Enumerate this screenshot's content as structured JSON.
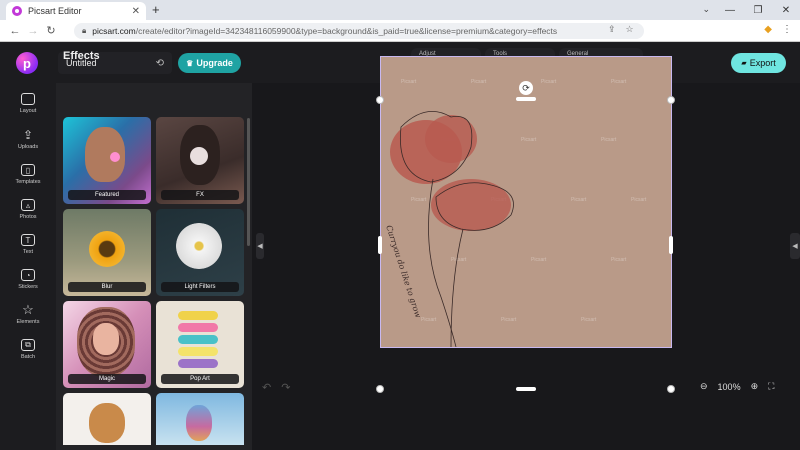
{
  "browser": {
    "tab_title": "Picsart Editor",
    "url_host": "picsart.com",
    "url_rest": "/create/editor?imageId=342348116059900&type=background&is_paid=true&license=premium&category=effects"
  },
  "app": {
    "document_title": "Untitled",
    "upgrade_label": "Upgrade",
    "export_label": "Export",
    "tool_groups": [
      {
        "label": "Adjust"
      },
      {
        "label": "Tools"
      },
      {
        "label": "General"
      }
    ],
    "zoom_level": "100%"
  },
  "sidebar": {
    "items": [
      {
        "label": "Layout",
        "icon": "layout-icon"
      },
      {
        "label": "Uploads",
        "icon": "upload-icon"
      },
      {
        "label": "Templates",
        "icon": "templates-icon"
      },
      {
        "label": "Photos",
        "icon": "photos-icon"
      },
      {
        "label": "Text",
        "icon": "text-icon"
      },
      {
        "label": "Stickers",
        "icon": "stickers-icon"
      },
      {
        "label": "Elements",
        "icon": "elements-icon"
      },
      {
        "label": "Batch",
        "icon": "batch-icon"
      }
    ]
  },
  "panel": {
    "title": "Effects",
    "effects": [
      {
        "label": "Featured"
      },
      {
        "label": "FX"
      },
      {
        "label": "Blur"
      },
      {
        "label": "Light Filters"
      },
      {
        "label": "Magic"
      },
      {
        "label": "Pop Art"
      }
    ]
  },
  "canvas": {
    "handwriting": "Curryou do like to grow"
  }
}
